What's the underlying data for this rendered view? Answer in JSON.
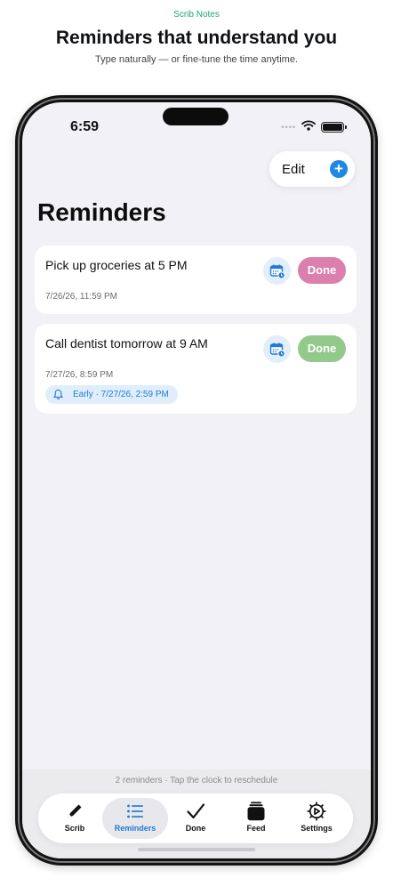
{
  "promo": {
    "brand": "Scrib Notes",
    "headline": "Reminders that understand you",
    "subheadline": "Type naturally — or fine-tune the time anytime."
  },
  "status_bar": {
    "time": "6:59",
    "icons": [
      "signal-dots-icon",
      "wifi-icon",
      "battery-icon"
    ]
  },
  "header": {
    "edit_label": "Edit",
    "add_icon": "plus-circle-icon",
    "title": "Reminders"
  },
  "reminders": [
    {
      "title": "Pick up groceries at 5 PM",
      "date": "7/26/26, 11:59 PM",
      "schedule_icon": "calendar-clock-icon",
      "done_label": "Done",
      "done_color": "#db7fae"
    },
    {
      "title": "Call dentist tomorrow at 9 AM",
      "date": "7/27/26, 8:59 PM",
      "schedule_icon": "calendar-clock-icon",
      "done_label": "Done",
      "done_color": "#93c98b",
      "early_alert": "Early · 7/27/26, 2:59 PM"
    }
  ],
  "footer": {
    "summary": "2 reminders · Tap the clock to reschedule"
  },
  "tabs": [
    {
      "label": "Scrib",
      "icon": "pencil-icon",
      "selected": false
    },
    {
      "label": "Reminders",
      "icon": "list-icon",
      "selected": true
    },
    {
      "label": "Done",
      "icon": "checkmark-icon",
      "selected": false
    },
    {
      "label": "Feed",
      "icon": "stack-icon",
      "selected": false
    },
    {
      "label": "Settings",
      "icon": "gear-icon",
      "selected": false
    }
  ],
  "colors": {
    "accent": "#1e7ad6",
    "brand": "#1ea672",
    "background": "#f2f2f6"
  }
}
